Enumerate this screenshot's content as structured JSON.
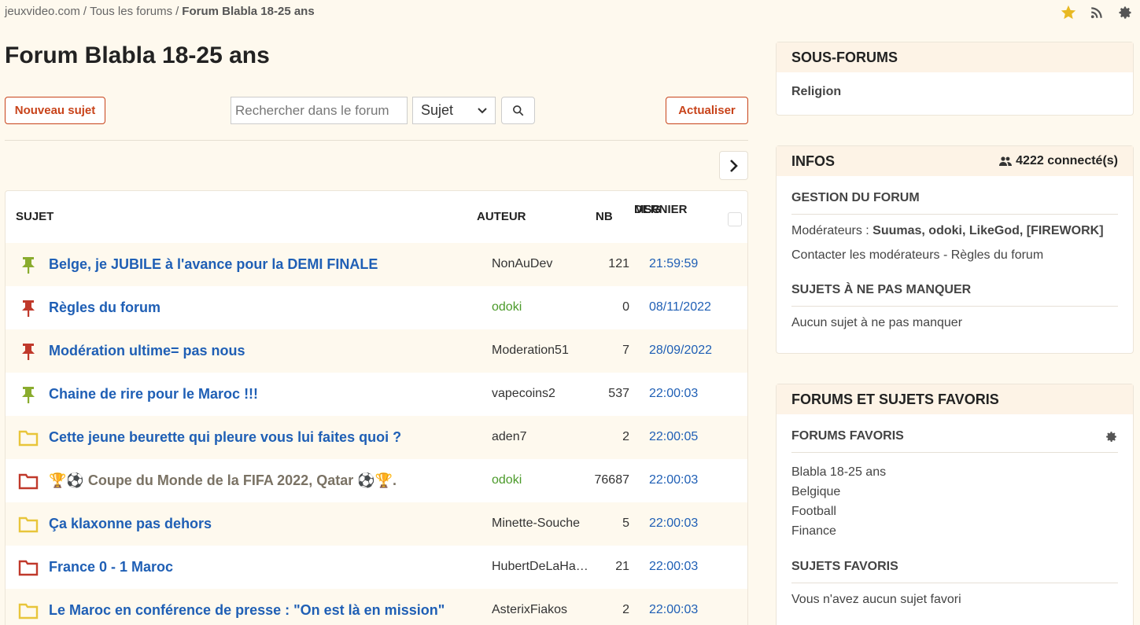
{
  "breadcrumb": {
    "home": "jeuxvideo.com",
    "sep1": "/",
    "forums": "Tous les forums",
    "sep2": "/",
    "current": "Forum Blabla 18-25 ans"
  },
  "page_title": "Forum Blabla 18-25 ans",
  "toolbar": {
    "new_topic": "Nouveau sujet",
    "search_placeholder": "Rechercher dans le forum",
    "search_select": "Sujet",
    "refresh": "Actualiser"
  },
  "table": {
    "headers": {
      "subject": "SUJET",
      "author": "AUTEUR",
      "nb": "NB",
      "last_line1": "DERNIER",
      "last_line2": "MSG"
    },
    "rows": [
      {
        "icon": "pin-green-icon",
        "title": "Belge, je JUBILE à l'avance pour la DEMI FINALE",
        "author": "NonAuDev",
        "nb": "121",
        "last": "21:59:59"
      },
      {
        "icon": "pin-red-icon",
        "title": "Règles du forum",
        "author": "odoki",
        "nb": "0",
        "last": "08/11/2022"
      },
      {
        "icon": "pin-red-icon",
        "title": "Modération ultime= pas nous",
        "author": "Moderation51",
        "nb": "7",
        "last": "28/09/2022"
      },
      {
        "icon": "pin-green-icon",
        "title": "Chaine de rire pour le Maroc !!!",
        "author": "vapecoins2",
        "nb": "537",
        "last": "22:00:03"
      },
      {
        "icon": "folder-yellow-icon",
        "title": "Cette jeune beurette qui pleure vous lui faites quoi ?",
        "author": "aden7",
        "nb": "2",
        "last": "22:00:05"
      },
      {
        "icon": "folder-red-icon",
        "title": "🏆⚽ Coupe du Monde de la FIFA 2022, Qatar ⚽🏆.",
        "author": "odoki",
        "nb": "76687",
        "last": "22:00:03"
      },
      {
        "icon": "folder-yellow-icon",
        "title": "Ça klaxonne pas dehors",
        "author": "Minette-Souche",
        "nb": "5",
        "last": "22:00:03"
      },
      {
        "icon": "folder-red-icon",
        "title": "France 0 - 1 Maroc",
        "author": "HubertDeLaHa…",
        "nb": "21",
        "last": "22:00:03"
      },
      {
        "icon": "folder-yellow-icon",
        "title": "Le Maroc en conférence de presse : \"On est là en mission\"",
        "author": "AsterixFiakos",
        "nb": "2",
        "last": "22:00:03"
      }
    ]
  },
  "sous_forums": {
    "title": "SOUS-FORUMS",
    "items": [
      "Religion"
    ]
  },
  "infos": {
    "title": "INFOS",
    "connected": "4222 connecté(s)",
    "gestion_title": "GESTION DU FORUM",
    "mods_label": "Modérateurs :",
    "mods_list": "Suumas, odoki, LikeGod, [FIREWORK]",
    "contact": "Contacter les modérateurs",
    "contact_sep": " - ",
    "rules": "Règles du forum",
    "must_title": "SUJETS À NE PAS MANQUER",
    "must_text": "Aucun sujet à ne pas manquer"
  },
  "favoris": {
    "title": "FORUMS ET SUJETS FAVORIS",
    "forums_title": "FORUMS FAVORIS",
    "forums": [
      "Blabla 18-25 ans",
      "Belgique",
      "Football",
      "Finance"
    ],
    "topics_title": "SUJETS FAVORIS",
    "topics_text": "Vous n'avez aucun sujet favori"
  },
  "colors": {
    "accent": "#c8431a",
    "link": "#1f5fb5",
    "moderator": "#4b9a2a",
    "pin_green": "#8aac2e",
    "pin_red": "#c0392b",
    "folder_yellow": "#e8c53a",
    "folder_red": "#c0392b"
  }
}
